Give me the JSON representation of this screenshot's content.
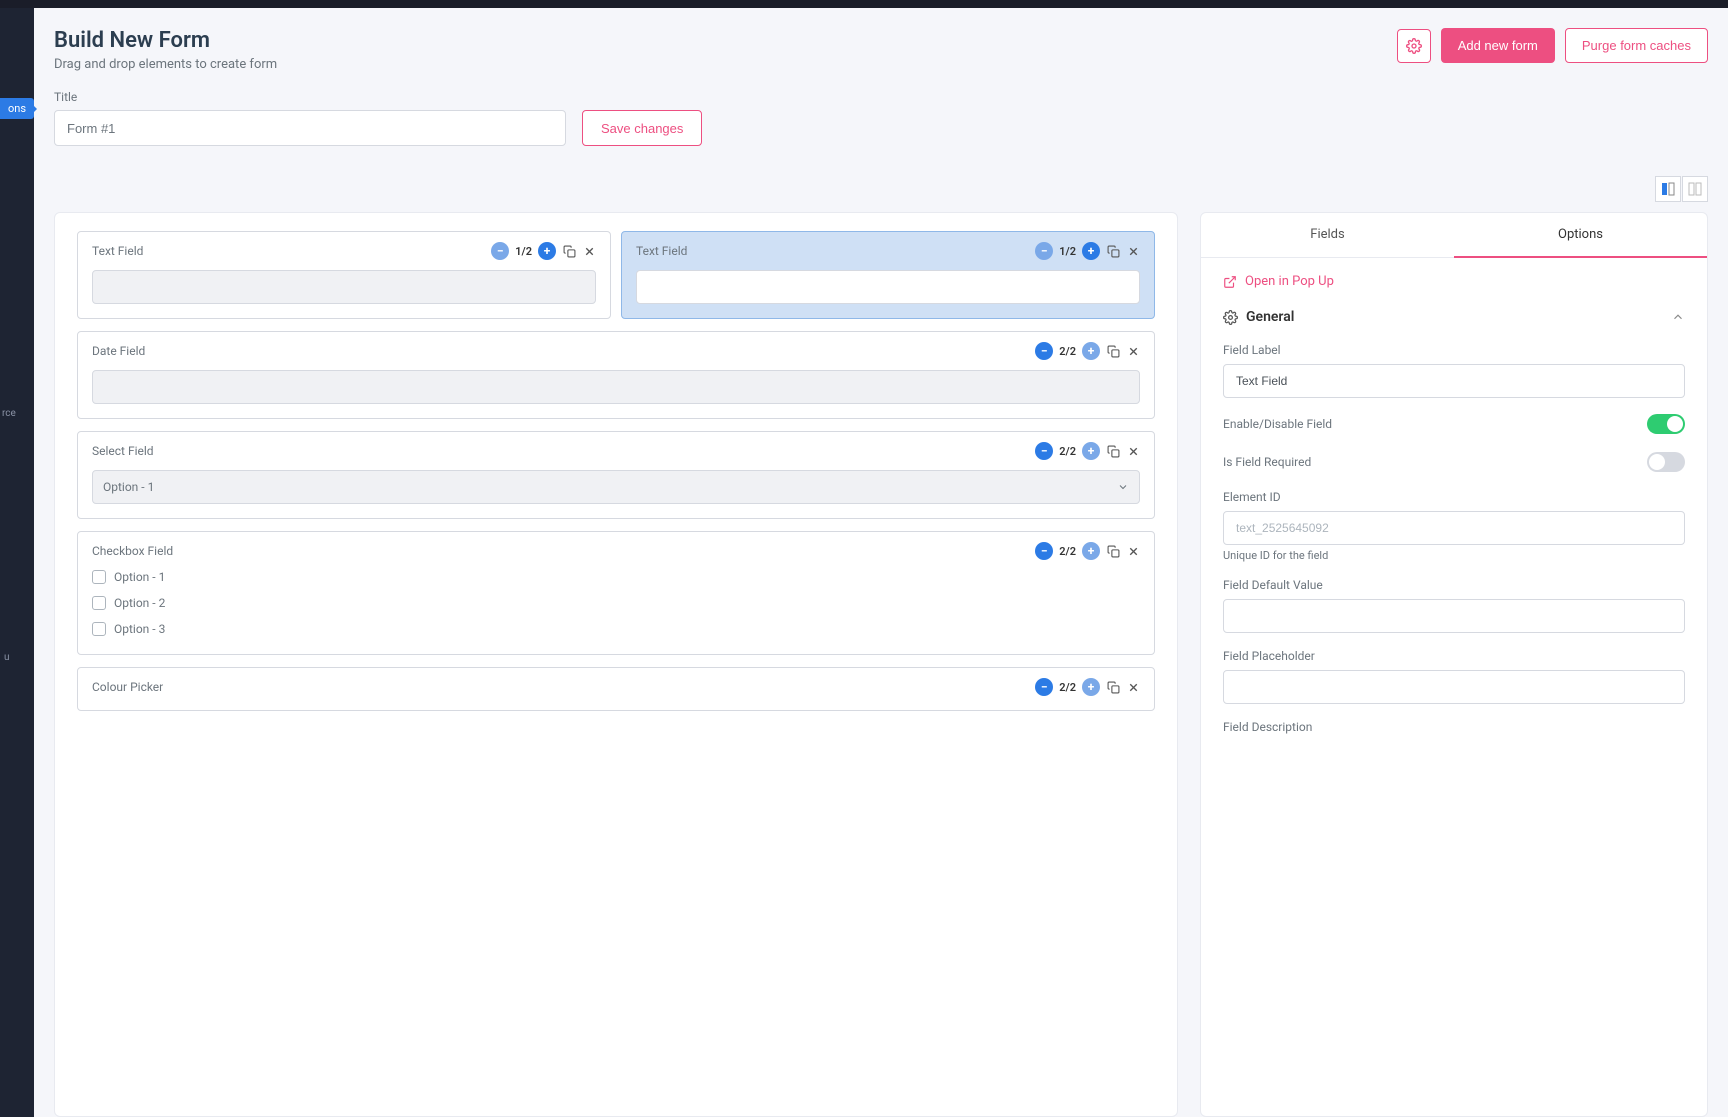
{
  "sidebar": {
    "active_tab": "ons",
    "item1": "rce",
    "item2": "u"
  },
  "header": {
    "title": "Build New Form",
    "subtitle": "Drag and drop elements to create form",
    "add_button": "Add new form",
    "purge_button": "Purge form caches"
  },
  "title_section": {
    "label": "Title",
    "value": "Form #1",
    "save_button": "Save changes"
  },
  "fields": {
    "text1": {
      "label": "Text Field",
      "fraction": "1/2"
    },
    "text2": {
      "label": "Text Field",
      "fraction": "1/2"
    },
    "date": {
      "label": "Date Field",
      "fraction": "2/2"
    },
    "select": {
      "label": "Select Field",
      "fraction": "2/2",
      "selected": "Option - 1"
    },
    "checkbox": {
      "label": "Checkbox Field",
      "fraction": "2/2",
      "options": [
        "Option - 1",
        "Option - 2",
        "Option - 3"
      ]
    },
    "colour": {
      "label": "Colour Picker",
      "fraction": "2/2"
    }
  },
  "panel": {
    "tab_fields": "Fields",
    "tab_options": "Options",
    "popup_link": "Open in Pop Up",
    "section_general": "General",
    "field_label": {
      "label": "Field Label",
      "value": "Text Field"
    },
    "enable_label": "Enable/Disable Field",
    "required_label": "Is Field Required",
    "element_id": {
      "label": "Element ID",
      "placeholder": "text_2525645092",
      "help": "Unique ID for the field"
    },
    "default_value_label": "Field Default Value",
    "placeholder_label": "Field Placeholder",
    "description_label": "Field Description"
  }
}
